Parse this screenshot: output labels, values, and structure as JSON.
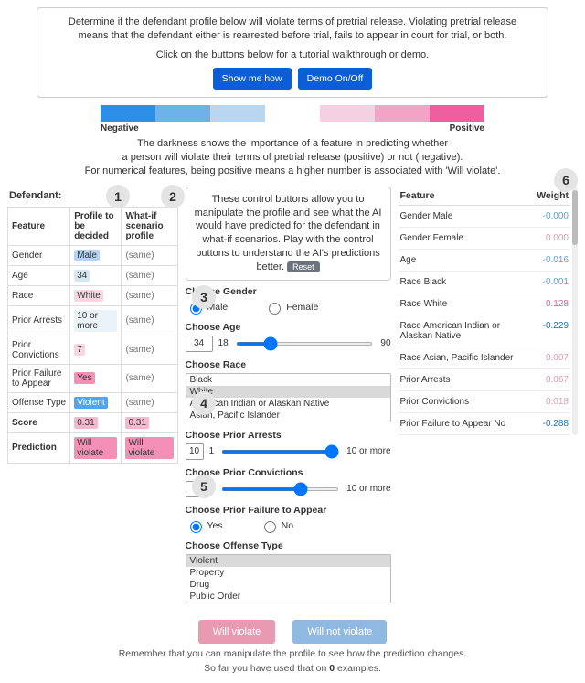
{
  "intro": {
    "line1": "Determine if the defendant profile below will violate terms of pretrial release. Violating pretrial release means that the defendant either is rearrested before trial, fails to appear in court for trial, or both.",
    "line2": "Click on the buttons below for a tutorial walkthrough or demo.",
    "btn_show": "Show me how",
    "btn_demo": "Demo On/Off"
  },
  "legend": {
    "neg": "Negative",
    "pos": "Positive",
    "caption1": "The darkness shows the importance of a feature in predicting whether",
    "caption2": "a person will violate their terms of pretrial release (positive) or not (negative).",
    "caption3": "For numerical features, being positive means a higher number is associated with 'Will violate'.",
    "colors": [
      "#2d8ee6",
      "#6fb1ea",
      "#b6d6f2",
      "#ffffff",
      "#f6cfe0",
      "#f3a4c6",
      "#ee5fa0"
    ]
  },
  "callouts": {
    "c1": "1",
    "c2": "2",
    "c3": "3",
    "c4": "4",
    "c5": "5",
    "c6": "6"
  },
  "profile": {
    "defendant_label": "Defendant:",
    "hdr_feature": "Feature",
    "hdr_profile": "Profile to be decided",
    "hdr_whatif": "What-if scenario profile",
    "same": "(same)",
    "rows": {
      "gender": {
        "label": "Gender",
        "value": "Male"
      },
      "age": {
        "label": "Age",
        "value": "34"
      },
      "race": {
        "label": "Race",
        "value": "White"
      },
      "arrests": {
        "label": "Prior Arrests",
        "value": "10 or more"
      },
      "conv": {
        "label": "Prior Convictions",
        "value": "7"
      },
      "fta": {
        "label": "Prior Failure to Appear",
        "value": "Yes"
      },
      "offense": {
        "label": "Offense Type",
        "value": "Violent"
      },
      "score": {
        "label": "Score",
        "value": "0.31",
        "whatif": "0.31"
      },
      "pred": {
        "label": "Prediction",
        "value": "Will violate",
        "whatif": "Will violate"
      }
    }
  },
  "controls": {
    "help": "These control buttons allow you to manipulate the profile and see what the AI would have predicted for the defendant in what-if scenarios. Play with the control buttons to understand the AI's predictions better.",
    "reset": "Reset",
    "gender": {
      "label": "Choose Gender",
      "opt1": "Male",
      "opt2": "Female"
    },
    "age": {
      "label": "Choose Age",
      "value": "34",
      "min": "18",
      "max": "90"
    },
    "race": {
      "label": "Choose Race",
      "opts": [
        "Black",
        "White",
        "American Indian or Alaskan Native",
        "Asian, Pacific Islander"
      ],
      "selected": "White"
    },
    "arrests": {
      "label": "Choose Prior Arrests",
      "value": "10",
      "min": "1",
      "max": "10 or more"
    },
    "conv": {
      "label": "Choose Prior Convictions",
      "value": "7",
      "min": "0",
      "max": "10 or more"
    },
    "fta": {
      "label": "Choose Prior Failure to Appear",
      "opt1": "Yes",
      "opt2": "No"
    },
    "offense": {
      "label": "Choose Offense Type",
      "opts": [
        "Violent",
        "Property",
        "Drug",
        "Public Order"
      ],
      "selected": "Violent"
    }
  },
  "weights": {
    "hdr_feature": "Feature",
    "hdr_weight": "Weight",
    "rows": [
      {
        "label": "Gender Male",
        "value": "-0.000",
        "cls": "w-neg"
      },
      {
        "label": "Gender Female",
        "value": "0.000",
        "cls": "w-pos"
      },
      {
        "label": "Age",
        "value": "-0.016",
        "cls": "w-neg"
      },
      {
        "label": "Race Black",
        "value": "-0.001",
        "cls": "w-neg"
      },
      {
        "label": "Race White",
        "value": "0.128",
        "cls": "w-pos-strong"
      },
      {
        "label": "Race American Indian or Alaskan Native",
        "value": "-0.229",
        "cls": "w-neg-strong"
      },
      {
        "label": "Race Asian, Pacific Islander",
        "value": "0.007",
        "cls": "w-pos"
      },
      {
        "label": "Prior Arrests",
        "value": "0.067",
        "cls": "w-pos"
      },
      {
        "label": "Prior Convictions",
        "value": "0.018",
        "cls": "w-pos"
      },
      {
        "label": "Prior Failure to Appear No",
        "value": "-0.288",
        "cls": "w-neg-strong"
      }
    ]
  },
  "predict": {
    "violate": "Will violate",
    "not": "Will not violate"
  },
  "footer": {
    "line1": "Remember that you can manipulate the profile to see how the prediction changes.",
    "line2a": "So far you have used that on ",
    "count": "0",
    "line2b": " examples."
  }
}
